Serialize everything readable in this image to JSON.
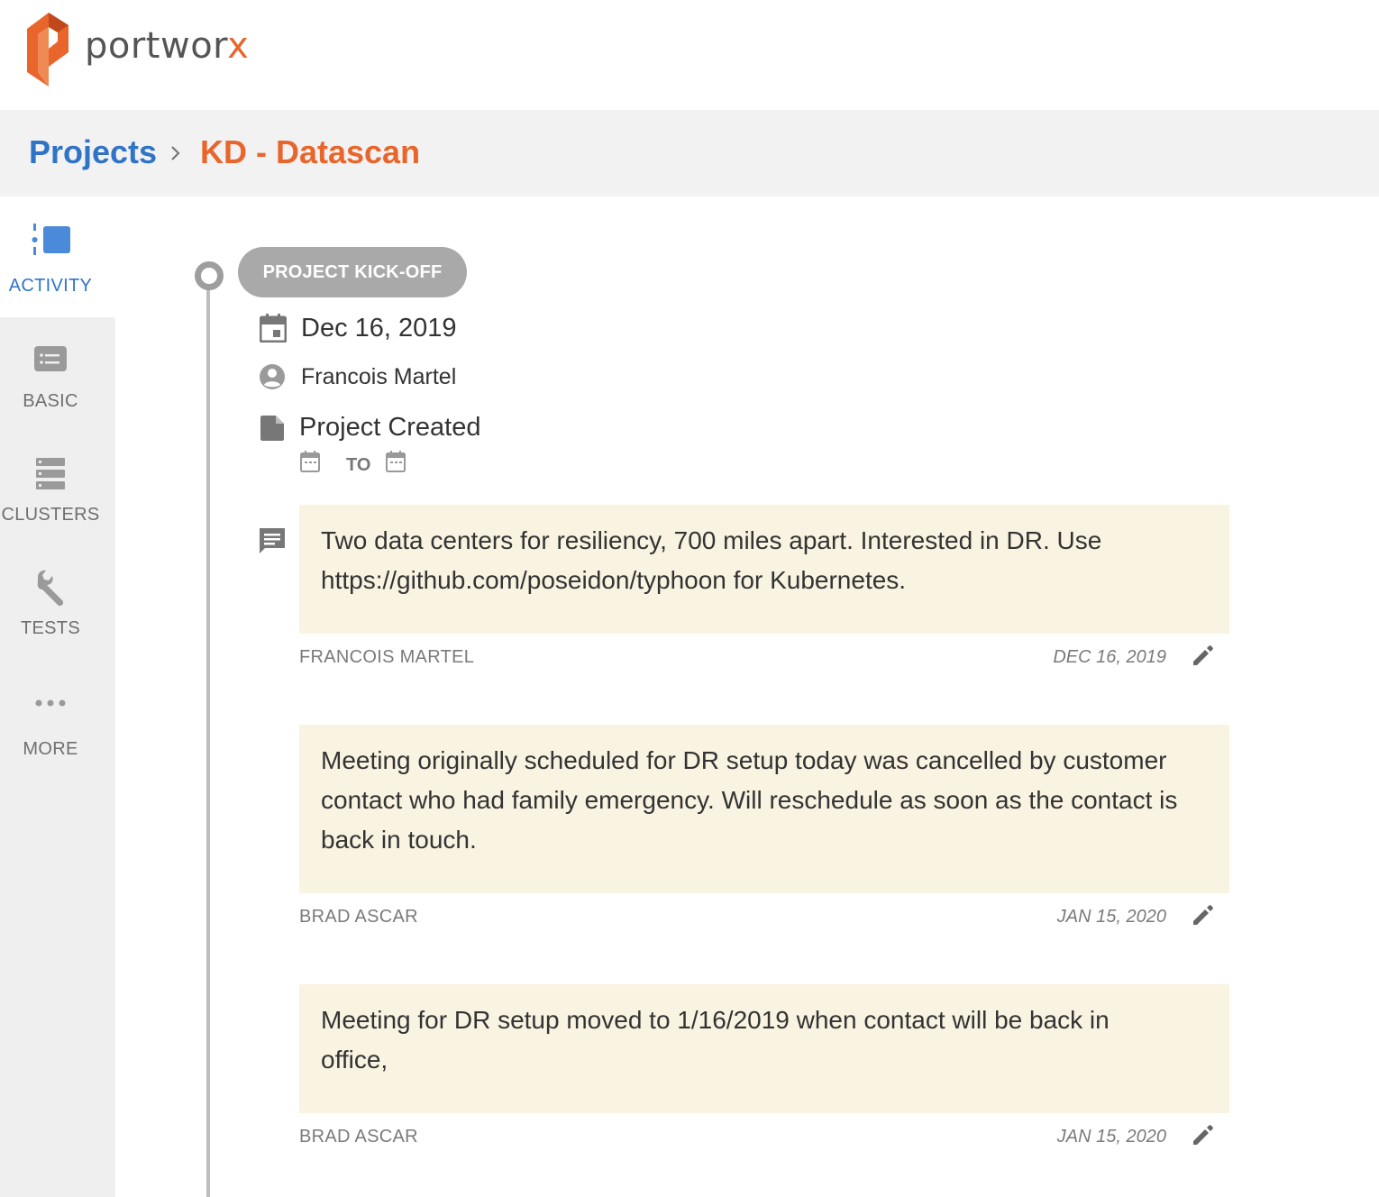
{
  "brand": {
    "name_main": "portwor",
    "name_accent": "x",
    "accent_color": "#e8662c"
  },
  "breadcrumb": {
    "root": "Projects",
    "current": "KD - Datascan"
  },
  "sidebar": {
    "items": [
      {
        "label": "ACTIVITY",
        "icon": "activity-icon",
        "active": true
      },
      {
        "label": "BASIC",
        "icon": "list-card-icon",
        "active": false
      },
      {
        "label": "CLUSTERS",
        "icon": "server-stack-icon",
        "active": false
      },
      {
        "label": "TESTS",
        "icon": "wrench-icon",
        "active": false
      },
      {
        "label": "MORE",
        "icon": "more-dots-icon",
        "active": false
      }
    ]
  },
  "milestone": {
    "label": "PROJECT KICK-OFF",
    "date": "Dec 16, 2019",
    "owner": "Francois Martel",
    "status": "Project Created",
    "range_separator": "TO"
  },
  "notes": [
    {
      "text": "Two data centers for resiliency, 700 miles apart. Interested in DR. Use https://github.com/poseidon/typhoon for Kubernetes.",
      "author": "FRANCOIS MARTEL",
      "date": "DEC 16, 2019"
    },
    {
      "text": "Meeting originally scheduled for DR setup today was cancelled by customer contact who had family emergency. Will reschedule as soon as the contact is back in touch.",
      "author": "BRAD ASCAR",
      "date": "JAN 15, 2020"
    },
    {
      "text": "Meeting for DR setup moved to 1/16/2019 when contact will be back in office,",
      "author": "BRAD ASCAR",
      "date": "JAN 15, 2020"
    }
  ],
  "colors": {
    "link_blue": "#2f74c7",
    "accent_orange": "#e8662c",
    "note_bg": "#f9f3e1"
  }
}
